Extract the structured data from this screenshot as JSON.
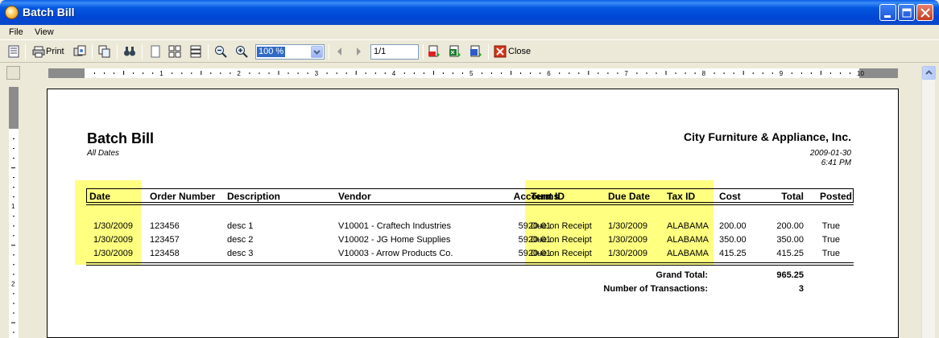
{
  "window": {
    "title": "Batch Bill"
  },
  "menu": [
    "File",
    "View"
  ],
  "toolbar": {
    "print_label": "Print",
    "zoom_value": "100 %",
    "page_value": "1/1",
    "close_label": "Close"
  },
  "ruler": {
    "numbers": [
      "1",
      "2",
      "3",
      "4",
      "5",
      "6",
      "7",
      "8",
      "9",
      "10"
    ],
    "vnumbers": [
      "1",
      "2"
    ]
  },
  "report": {
    "title": "Batch Bill",
    "subtitle": "All Dates",
    "company": "City Furniture & Appliance, Inc.",
    "date": "2009-01-30",
    "time": "6:41 PM",
    "columns": [
      "Date",
      "Order Number",
      "Description",
      "Vendor",
      "Account ID",
      "Terms",
      "Due Date",
      "Tax ID",
      "Cost",
      "Total",
      "Posted"
    ],
    "rows": [
      [
        "1/30/2009",
        "123456",
        "desc 1",
        "V10001 - Craftech Industries",
        "5920-01",
        "Due on Receipt",
        "1/30/2009",
        "ALABAMA",
        "200.00",
        "200.00",
        "True"
      ],
      [
        "1/30/2009",
        "123457",
        "desc 2",
        "V10002 - JG Home Supplies",
        "5920-01",
        "Due on Receipt",
        "1/30/2009",
        "ALABAMA",
        "350.00",
        "350.00",
        "True"
      ],
      [
        "1/30/2009",
        "123458",
        "desc 3",
        "V10003 - Arrow Products Co.",
        "5920-01",
        "Due on Receipt",
        "1/30/2009",
        "ALABAMA",
        "415.25",
        "415.25",
        "True"
      ]
    ],
    "grand_total_label": "Grand Total:",
    "grand_total_value": "965.25",
    "txn_label": "Number of Transactions:",
    "txn_value": "3"
  },
  "colors": {
    "highlight": "#ffff80",
    "titlebar": "#0046d5"
  }
}
